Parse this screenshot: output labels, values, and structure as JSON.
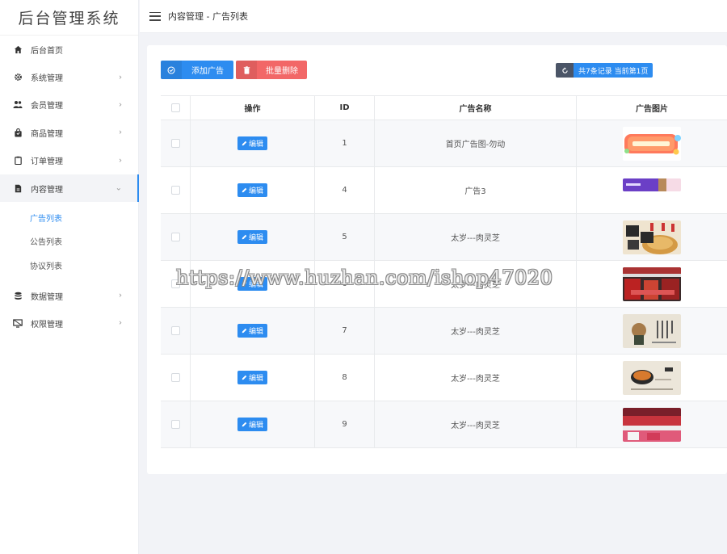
{
  "app": {
    "title": "后台管理系统"
  },
  "sidebar": {
    "items": [
      {
        "label": "后台首页",
        "icon": "home-icon",
        "has_children": false
      },
      {
        "label": "系统管理",
        "icon": "gear-icon",
        "has_children": true
      },
      {
        "label": "会员管理",
        "icon": "users-icon",
        "has_children": true
      },
      {
        "label": "商品管理",
        "icon": "bag-icon",
        "has_children": true
      },
      {
        "label": "订单管理",
        "icon": "clipboard-icon",
        "has_children": true
      },
      {
        "label": "内容管理",
        "icon": "document-icon",
        "has_children": true,
        "expanded": true
      },
      {
        "label": "数据管理",
        "icon": "database-icon",
        "has_children": true
      },
      {
        "label": "权限管理",
        "icon": "screen-icon",
        "has_children": true
      }
    ],
    "content_submenu": [
      {
        "label": "广告列表",
        "active": true
      },
      {
        "label": "公告列表",
        "active": false
      },
      {
        "label": "协议列表",
        "active": false
      }
    ]
  },
  "header": {
    "breadcrumb": "内容管理 - 广告列表"
  },
  "toolbar": {
    "add_label": "添加广告",
    "delete_label": "批量删除",
    "pager_text": "共7条记录 当前第1页"
  },
  "table": {
    "headers": {
      "op": "操作",
      "id": "ID",
      "name": "广告名称",
      "image": "广告图片"
    },
    "edit_label": "编辑",
    "rows": [
      {
        "id": "1",
        "name": "首页广告图-勿动",
        "image": "promo-banner"
      },
      {
        "id": "4",
        "name": "广告3",
        "image": "purple-strip"
      },
      {
        "id": "5",
        "name": "太岁---肉灵芝",
        "image": "lingzhi-text"
      },
      {
        "id": "6",
        "name": "太岁---肉灵芝",
        "image": "store-red"
      },
      {
        "id": "7",
        "name": "太岁---肉灵芝",
        "image": "ink-painting"
      },
      {
        "id": "8",
        "name": "太岁---肉灵芝",
        "image": "bowl-scroll"
      },
      {
        "id": "9",
        "name": "太岁---肉灵芝",
        "image": "shop-interior"
      }
    ]
  },
  "watermark": "https://www.huzhan.com/ishop47020",
  "colors": {
    "primary": "#2d8cf0",
    "danger": "#f26767",
    "dark": "#4b5567"
  }
}
